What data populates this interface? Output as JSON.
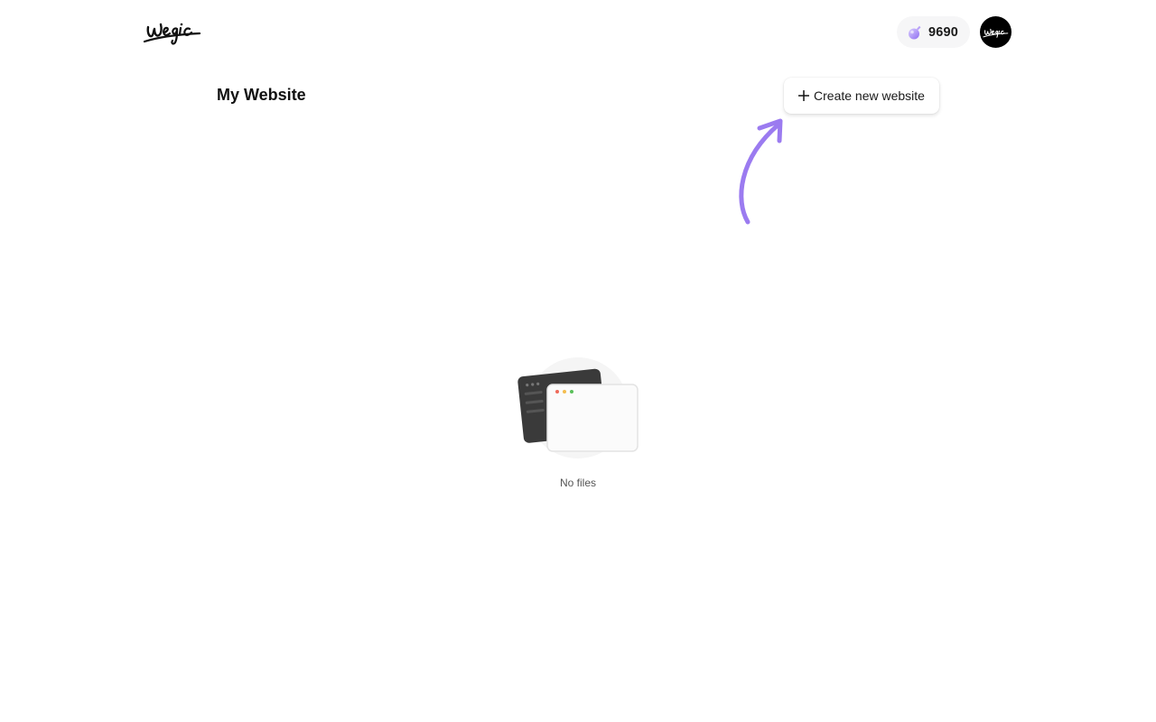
{
  "header": {
    "brand_name": "Wegic",
    "credits": "9690"
  },
  "main": {
    "title": "My Website",
    "create_button_label": "Create new website",
    "empty_state_text": "No files"
  },
  "icons": {
    "logo": "wegic-logo-icon",
    "credits": "gem-icon",
    "avatar": "wegic-avatar-icon",
    "create": "plus-icon",
    "hint": "hint-arrow-icon",
    "empty": "browser-windows-icon"
  },
  "colors": {
    "accent": "#9b7bf0",
    "gem": "#a98cf5"
  }
}
